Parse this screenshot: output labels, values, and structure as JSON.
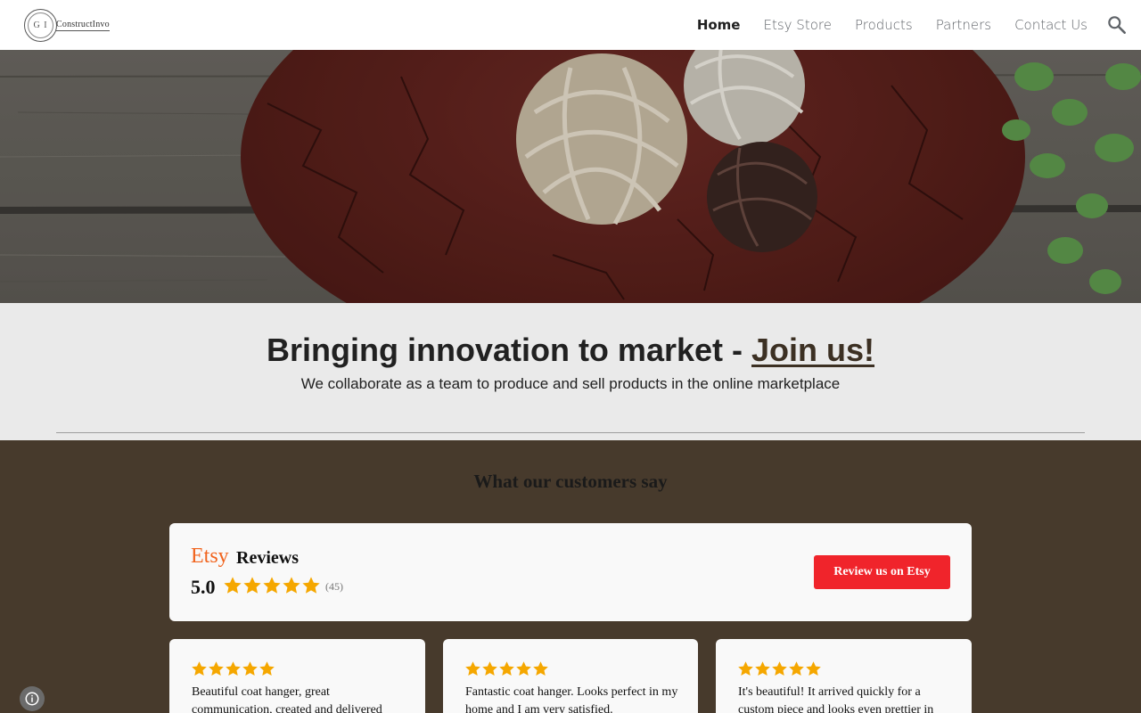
{
  "logo": {
    "monogram": "G I",
    "wordmark": "ConstructInvo"
  },
  "nav": {
    "items": [
      "Home",
      "Etsy Store",
      "Products",
      "Partners",
      "Contact Us"
    ],
    "active": "Home"
  },
  "search_icon": "search-icon",
  "tagline": {
    "headline_main": "Bringing innovation to market - ",
    "headline_link": "Join us!",
    "subheadline": "We collaborate as a team to produce and sell products in the online marketplace"
  },
  "reviews": {
    "section_title": "What our customers say",
    "platform": "Etsy",
    "label": "Reviews",
    "rating": "5.0",
    "stars": 5,
    "count": "(45)",
    "button_label": "Review us on Etsy",
    "items": [
      {
        "stars": 5,
        "text": "Beautiful coat hanger, great communication, created and delivered"
      },
      {
        "stars": 5,
        "text": "Fantastic coat hanger. Looks perfect in my home and I am very satisfied."
      },
      {
        "stars": 5,
        "text": "It's beautiful! It arrived quickly for a custom piece and looks even prettier in"
      }
    ]
  },
  "colors": {
    "etsy_orange": "#f1641e",
    "button_red": "#f0242b",
    "star_gold": "#f5a700",
    "section_brown": "#473a2c"
  }
}
